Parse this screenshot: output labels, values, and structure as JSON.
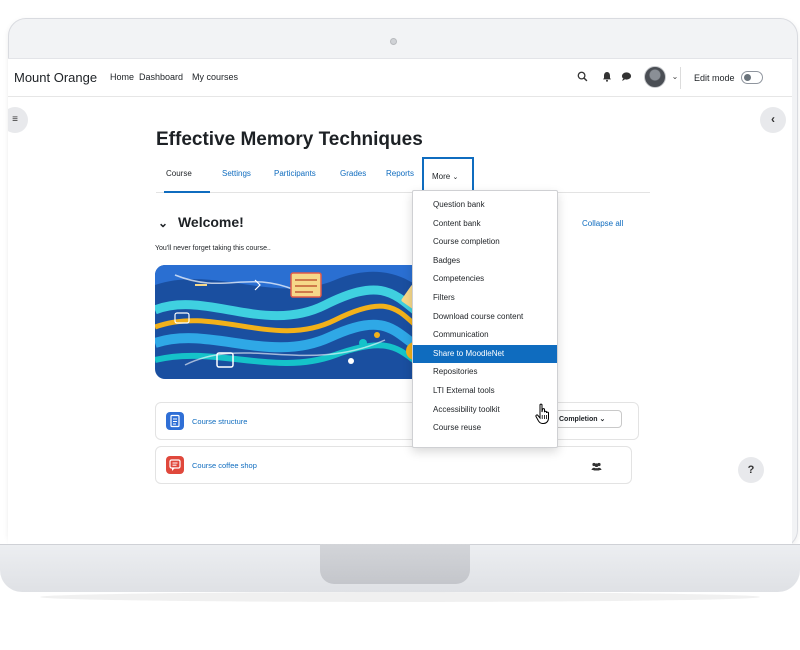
{
  "navbar": {
    "brand": "Mount Orange",
    "links": [
      "Home",
      "Dashboard",
      "My courses"
    ],
    "edit_mode_label": "Edit mode",
    "icons": [
      "search-icon",
      "bell-icon",
      "chat-icon",
      "avatar",
      "chevron-down-icon"
    ]
  },
  "course": {
    "title": "Effective Memory Techniques",
    "tabs": [
      "Course",
      "Settings",
      "Participants",
      "Grades",
      "Reports"
    ],
    "more_label": "More",
    "section_title": "Welcome!",
    "section_summary": "You'll never forget taking this course..",
    "collapse_all": "Collapse all",
    "activities": [
      {
        "name": "Course structure",
        "icon": "file-icon",
        "color": "#2f6fd6"
      },
      {
        "name": "Course coffee shop",
        "icon": "forum-icon",
        "color": "#e0483c"
      }
    ],
    "completion_label": "Completion"
  },
  "more_menu": {
    "items": [
      "Question bank",
      "Content bank",
      "Course completion",
      "Badges",
      "Competencies",
      "Filters",
      "Download course content",
      "Communication",
      "Share to MoodleNet",
      "Repositories",
      "LTI External tools",
      "Accessibility toolkit",
      "Course reuse"
    ],
    "highlighted": "Share to MoodleNet"
  },
  "colors": {
    "accent": "#0f6cbf",
    "text": "#1d2125"
  },
  "help_label": "?"
}
